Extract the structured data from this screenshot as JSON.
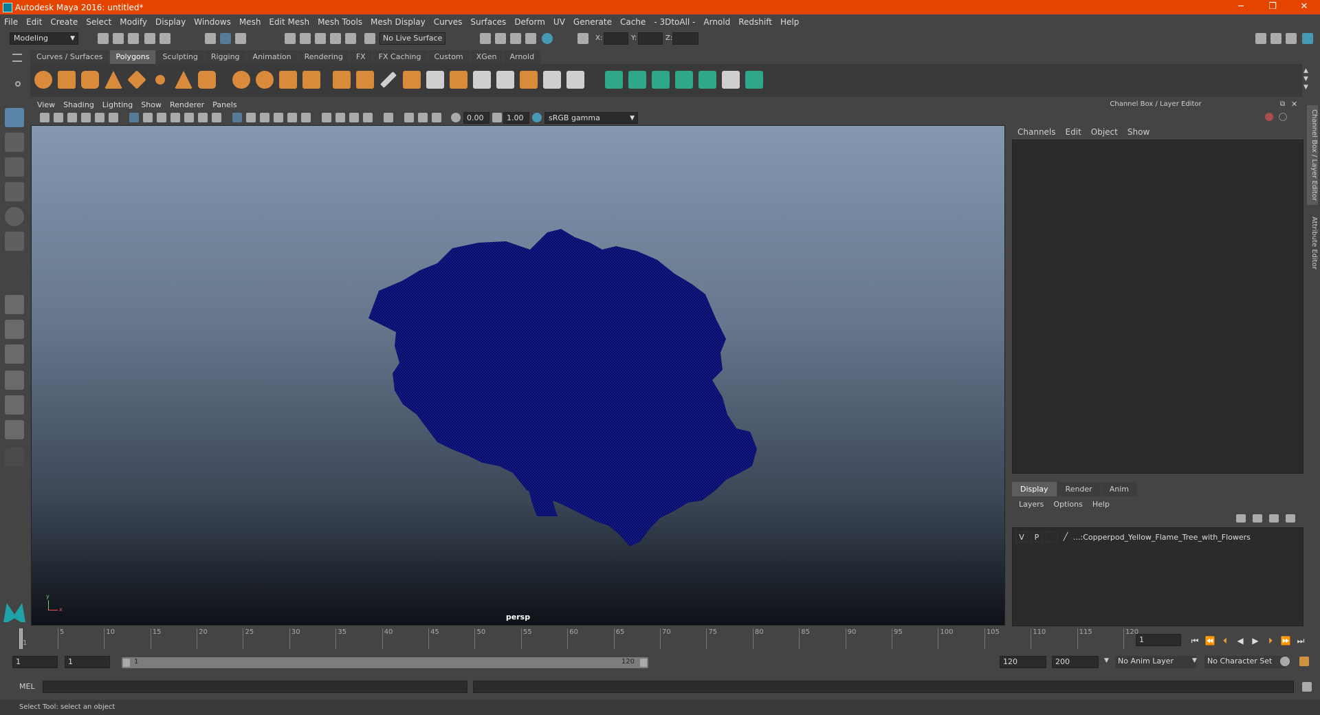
{
  "window": {
    "title": "Autodesk Maya 2016: untitled*"
  },
  "menubar": [
    "File",
    "Edit",
    "Create",
    "Select",
    "Modify",
    "Display",
    "Windows",
    "Mesh",
    "Edit Mesh",
    "Mesh Tools",
    "Mesh Display",
    "Curves",
    "Surfaces",
    "Deform",
    "UV",
    "Generate",
    "Cache",
    "- 3DtoAll -",
    "Arnold",
    "Redshift",
    "Help"
  ],
  "status": {
    "mode": "Modeling",
    "live_surface": "No Live Surface",
    "x_label": "X:",
    "y_label": "Y:",
    "z_label": "Z:"
  },
  "shelf": {
    "tabs": [
      "Curves / Surfaces",
      "Polygons",
      "Sculpting",
      "Rigging",
      "Animation",
      "Rendering",
      "FX",
      "FX Caching",
      "Custom",
      "XGen",
      "Arnold"
    ],
    "active_tab": "Polygons"
  },
  "viewport": {
    "menu": [
      "View",
      "Shading",
      "Lighting",
      "Show",
      "Renderer",
      "Panels"
    ],
    "exposure": "0.00",
    "gamma": "1.00",
    "color_space": "sRGB gamma",
    "camera": "persp",
    "axis_y": "y",
    "axis_x": "x"
  },
  "right_panel": {
    "title": "Channel Box / Layer Editor",
    "channel_menu": [
      "Channels",
      "Edit",
      "Object",
      "Show"
    ],
    "tabs": [
      "Display",
      "Render",
      "Anim"
    ],
    "active_tab": "Display",
    "layer_menu": [
      "Layers",
      "Options",
      "Help"
    ],
    "layer": {
      "v": "V",
      "p": "P",
      "name": "...:Copperpod_Yellow_Flame_Tree_with_Flowers"
    },
    "side_tabs": [
      "Channel Box / Layer Editor",
      "Attribute Editor"
    ]
  },
  "timeline": {
    "ticks": [
      "1",
      "5",
      "10",
      "15",
      "20",
      "25",
      "30",
      "35",
      "40",
      "45",
      "50",
      "55",
      "60",
      "65",
      "70",
      "75",
      "80",
      "85",
      "90",
      "95",
      "100",
      "105",
      "110",
      "115",
      "120"
    ],
    "current_frame": "1",
    "range_start": "1",
    "range_start2": "1",
    "range_inner_start": "1",
    "range_inner_end": "120",
    "range_end": "120",
    "range_end2": "200",
    "anim_layer": "No Anim Layer",
    "char_set": "No Character Set"
  },
  "cmdline": {
    "label": "MEL"
  },
  "helpline": {
    "text": "Select Tool: select an object"
  }
}
